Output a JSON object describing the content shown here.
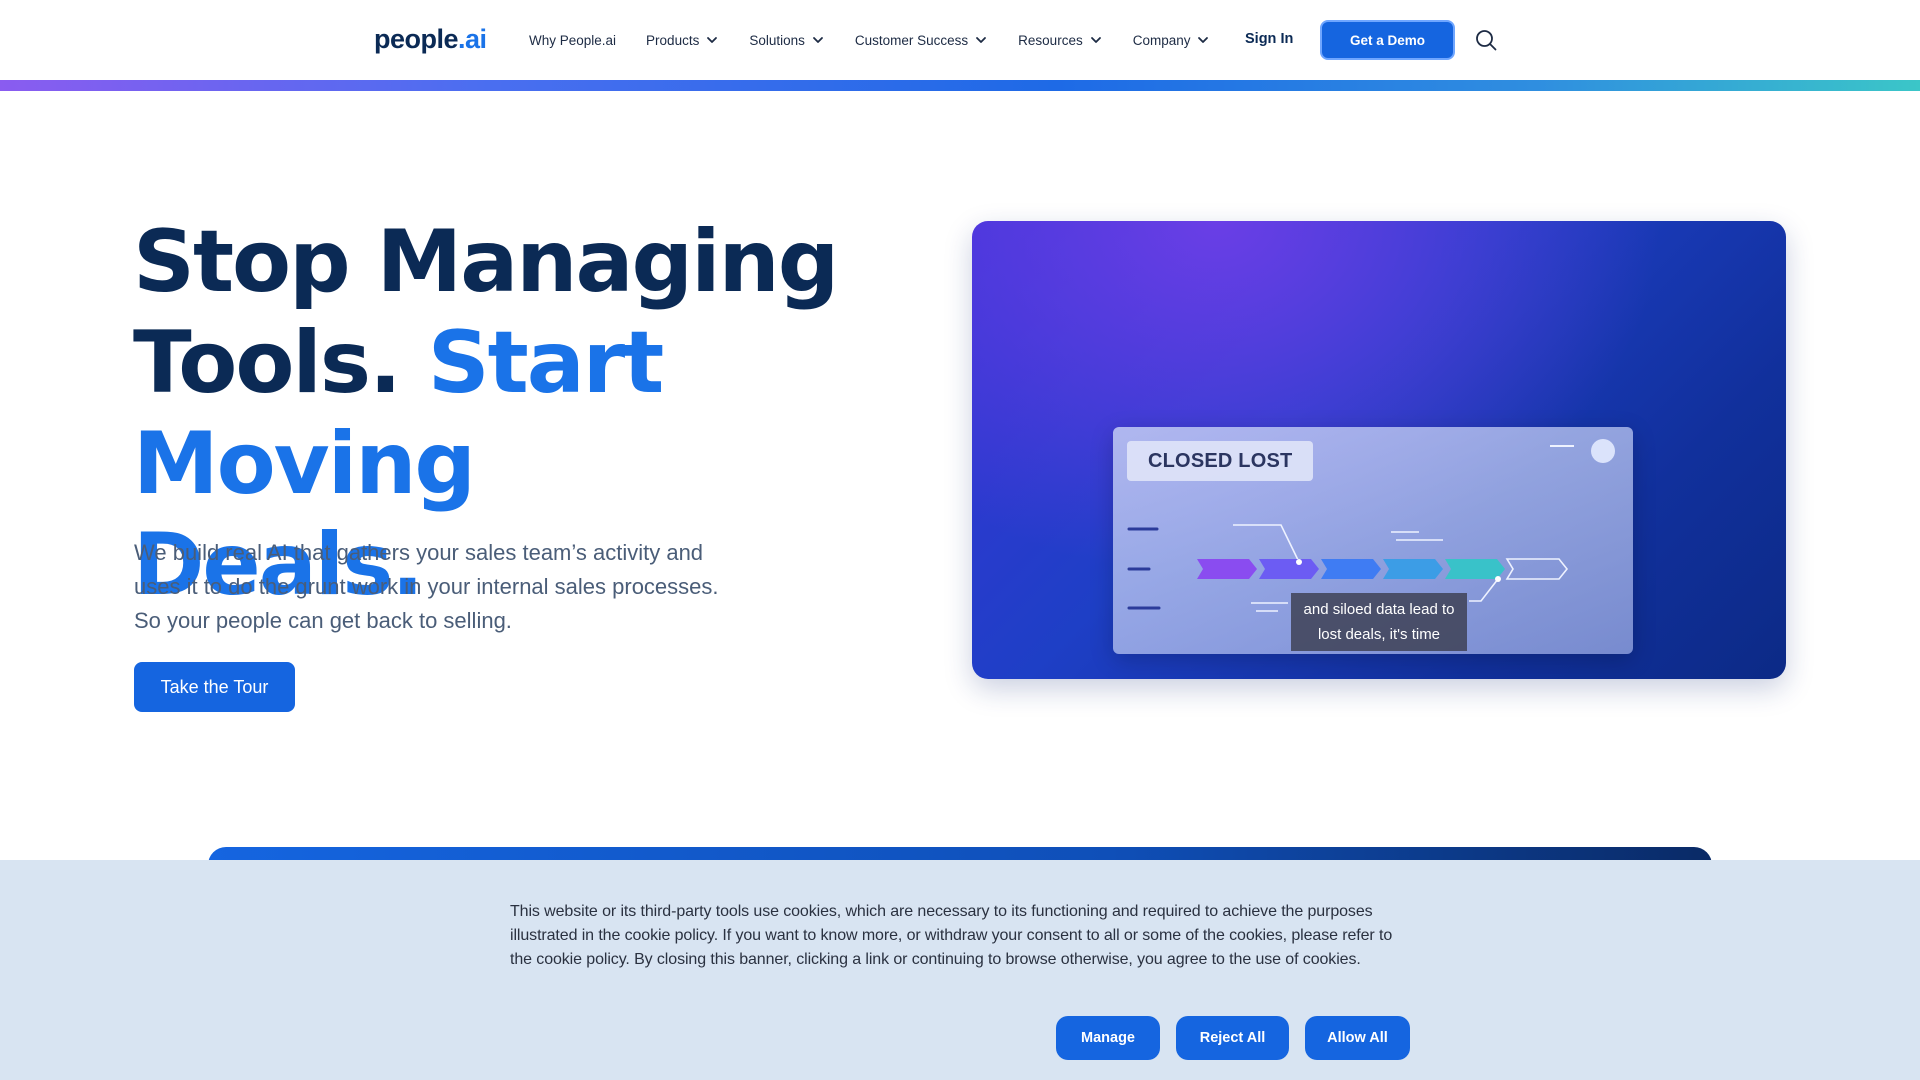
{
  "nav": {
    "logo_main": "people",
    "logo_accent": ".ai",
    "items": [
      {
        "label": "Why People.ai",
        "has_dropdown": false
      },
      {
        "label": "Products",
        "has_dropdown": true
      },
      {
        "label": "Solutions",
        "has_dropdown": true
      },
      {
        "label": "Customer Success",
        "has_dropdown": true
      },
      {
        "label": "Resources",
        "has_dropdown": true
      },
      {
        "label": "Company",
        "has_dropdown": true
      }
    ],
    "signin_label": "Sign In",
    "demo_label": "Get a Demo",
    "search_icon": "search-icon"
  },
  "hero": {
    "title_dark_1": "Stop Managing",
    "title_dark_2": "Tools. ",
    "title_accent_1": "Start Moving",
    "title_accent_2": "Deals.",
    "subtitle": "We build real AI that gathers your sales team’s activity and uses it to do the grunt work in your internal sales processes. So your people can get back to selling.",
    "tour_label": "Take the Tour"
  },
  "video": {
    "tag": "CLOSED LOST",
    "caption": "and siloed data lead to lost deals, it's time"
  },
  "cookie": {
    "text": "This website or its third-party tools use cookies, which are necessary to its functioning and required to achieve the purposes illustrated in the cookie policy. If you want to know more, or withdraw your consent to all or some of the cookies, please refer to the cookie policy. By closing this banner, clicking a link or continuing to browse otherwise, you agree to the use of cookies.",
    "manage_label": "Manage",
    "reject_label": "Reject All",
    "allow_label": "Allow All"
  },
  "colors": {
    "brand_blue": "#1565e0",
    "navy": "#0b2a55",
    "accent": "#1a73e8",
    "cookie_bg": "#d8e4f2"
  }
}
